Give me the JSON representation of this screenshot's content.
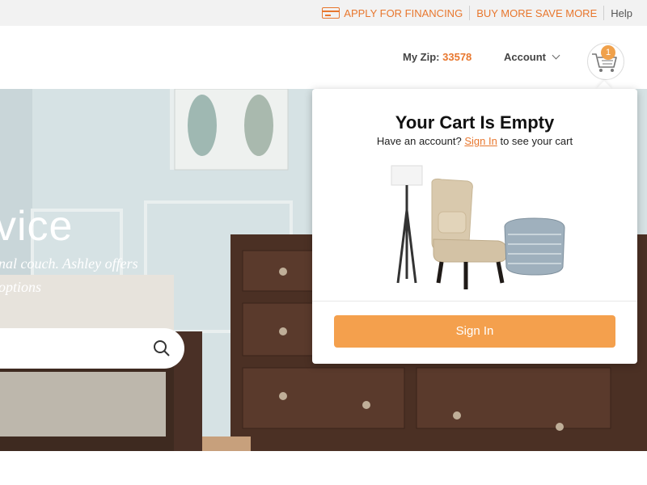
{
  "utility_bar": {
    "financing": "APPLY FOR FINANCING",
    "buy_more": "BUY MORE SAVE MORE",
    "help": "Help"
  },
  "header": {
    "zip_label": "My Zip:",
    "zip_value": "33578",
    "account_label": "Account",
    "cart_count": "1"
  },
  "hero": {
    "headline_fragment": "vice",
    "line1": "nal couch. Ashley offers",
    "line2": "options"
  },
  "cart_dropdown": {
    "title": "Your Cart Is Empty",
    "sub_prefix": "Have an account?",
    "sub_link": "Sign In",
    "sub_suffix": "to see your cart",
    "button": "Sign In"
  },
  "colors": {
    "accent": "#e8772e",
    "button": "#f4a04d",
    "badge": "#f0a14b"
  },
  "icons": {
    "card": "credit-card-icon",
    "cart": "shopping-cart-icon",
    "search": "search-icon",
    "chevron": "chevron-down-icon"
  }
}
